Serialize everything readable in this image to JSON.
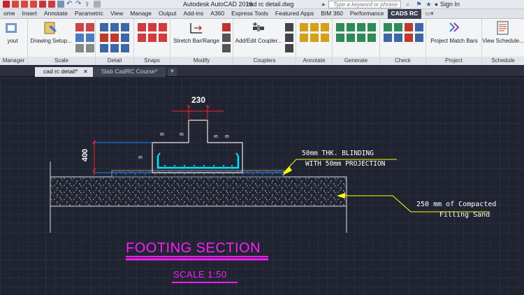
{
  "titlebar": {
    "app_name": "Autodesk AutoCAD 2016",
    "file_name": "cad rc detail.dwg",
    "search_placeholder": "Type a keyword or phrase",
    "signin": "Sign In"
  },
  "ribbon_tabs": [
    "ome",
    "Insert",
    "Annotate",
    "Parametric",
    "View",
    "Manage",
    "Output",
    "Add-ins",
    "A360",
    "Express Tools",
    "Featured Apps",
    "BIM 360",
    "Performance",
    "CADS RC"
  ],
  "active_ribbon_tab": "CADS RC",
  "ribbon": {
    "buttons": {
      "layout": "yout",
      "drawing_setup": "Drawing Setup...",
      "stretch": "Stretch Bar/Range",
      "add_coupler": "Add/Edit Coupler...",
      "project_match": "Project Match Bars",
      "view_schedule": "View Schedule..."
    },
    "panels": {
      "manager": "Manager",
      "scale": "Scale",
      "detail": "Detail",
      "snaps": "Snaps",
      "modify": "Modify",
      "couplers": "Couplers",
      "annotate": "Annotate",
      "generate": "Generate",
      "check": "Check",
      "project": "Project",
      "schedule": "Schedule"
    }
  },
  "doc_tabs": [
    {
      "label": "cad rc detail*",
      "active": true
    },
    {
      "label": "Slab CadRC Course*",
      "active": false
    }
  ],
  "drawing": {
    "dim_width": "230",
    "dim_height": "400",
    "small_labels": [
      "05",
      "05",
      "05",
      "05",
      "05"
    ],
    "callout_blinding_1": "50mm THK. BLINDING",
    "callout_blinding_2": "WITH 50mm PROJECTION",
    "callout_sand_1": "250 mm of Compacted",
    "callout_sand_2": "Filling Sand",
    "section_title": "FOOTING SECTION",
    "scale_label": "SCALE 1:50"
  },
  "colors": {
    "canvas_bg": "#1f2430",
    "grid_line": "#2c3342",
    "grid_major": "#343c4e",
    "magenta": "#ff1dff",
    "cyan": "#00e5ff",
    "leader_yellow": "#ffff00",
    "dim_red": "#ff2020",
    "active_tab": "#3b4150"
  }
}
